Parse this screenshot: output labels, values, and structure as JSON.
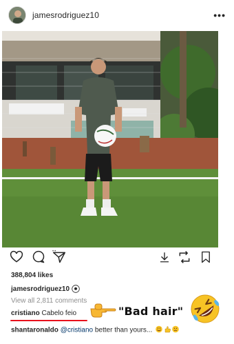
{
  "post": {
    "username": "jamesrodriguez10",
    "more_label": "•••",
    "likes": "388,804 likes",
    "caption_user": "jamesrodriguez10",
    "view_comments": "View all 2,811 comments",
    "comments": [
      {
        "user": "cristiano",
        "text": "Cabelo feio"
      },
      {
        "user": "shantaronaldo",
        "mention": "@cristiano",
        "text": " better than yours..."
      }
    ]
  },
  "overlay": {
    "annotation": "\"Bad hair\""
  },
  "icons": [
    "heart-icon",
    "comment-icon",
    "share-icon",
    "download-icon",
    "repost-icon",
    "bookmark-icon",
    "soccer-ball-icon",
    "pointing-hand-icon",
    "rofl-emoji-icon"
  ],
  "colors": {
    "underline": "#e8101c",
    "grass": "#5f8f3a",
    "muted": "#8e8e8e"
  }
}
